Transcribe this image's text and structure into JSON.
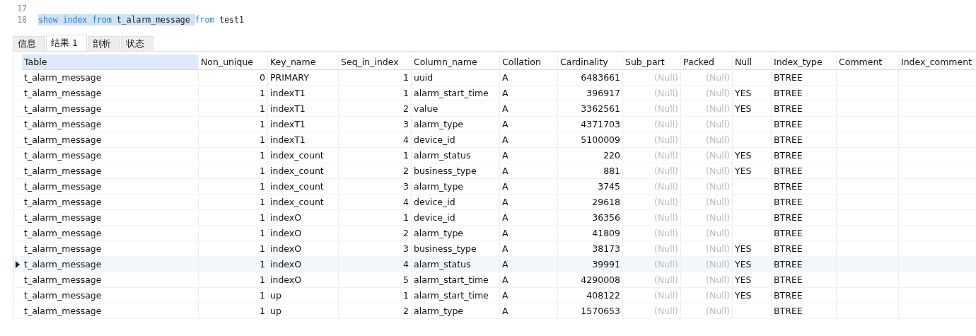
{
  "editor": {
    "lines": [
      {
        "number": "17"
      },
      {
        "number": "18",
        "tokens": [
          {
            "text": "show ",
            "kind": "keyword",
            "selected": true
          },
          {
            "text": "index ",
            "kind": "keyword",
            "selected": true
          },
          {
            "text": "from ",
            "kind": "keyword",
            "selected": true
          },
          {
            "text": "t_alarm_message ",
            "kind": "plain",
            "selected": true
          },
          {
            "text": "from ",
            "kind": "keyword",
            "selected": false
          },
          {
            "text": "test1",
            "kind": "plain",
            "selected": false
          }
        ]
      }
    ]
  },
  "tabs": [
    {
      "label": "信息",
      "selected": false
    },
    {
      "label": "结果 1",
      "selected": true
    },
    {
      "label": "剖析",
      "selected": false
    },
    {
      "label": "状态",
      "selected": false
    }
  ],
  "table": {
    "columns": [
      {
        "label": "Table",
        "kind": "text",
        "selected": true
      },
      {
        "label": "Non_unique",
        "kind": "number",
        "selected": false
      },
      {
        "label": "Key_name",
        "kind": "text",
        "selected": false
      },
      {
        "label": "Seq_in_index",
        "kind": "number",
        "selected": false
      },
      {
        "label": "Column_name",
        "kind": "text",
        "selected": false
      },
      {
        "label": "Collation",
        "kind": "text",
        "selected": false
      },
      {
        "label": "Cardinality",
        "kind": "number",
        "selected": false
      },
      {
        "label": "Sub_part",
        "kind": "null",
        "selected": false
      },
      {
        "label": "Packed",
        "kind": "null",
        "selected": false
      },
      {
        "label": "Null",
        "kind": "text",
        "selected": false
      },
      {
        "label": "Index_type",
        "kind": "text",
        "selected": false
      },
      {
        "label": "Comment",
        "kind": "text",
        "selected": false
      },
      {
        "label": "Index_comment",
        "kind": "text",
        "selected": false
      }
    ],
    "rows": [
      {
        "selected": false,
        "cells": [
          "t_alarm_message",
          "0",
          "PRIMARY",
          "1",
          "uuid",
          "A",
          "6483661",
          "(Null)",
          "(Null)",
          null,
          "BTREE",
          null,
          null
        ]
      },
      {
        "selected": false,
        "cells": [
          "t_alarm_message",
          "1",
          "indexT1",
          "1",
          "alarm_start_time",
          "A",
          "396917",
          "(Null)",
          "(Null)",
          "YES",
          "BTREE",
          null,
          null
        ]
      },
      {
        "selected": false,
        "cells": [
          "t_alarm_message",
          "1",
          "indexT1",
          "2",
          "value",
          "A",
          "3362561",
          "(Null)",
          "(Null)",
          "YES",
          "BTREE",
          null,
          null
        ]
      },
      {
        "selected": false,
        "cells": [
          "t_alarm_message",
          "1",
          "indexT1",
          "3",
          "alarm_type",
          "A",
          "4371703",
          "(Null)",
          "(Null)",
          null,
          "BTREE",
          null,
          null
        ]
      },
      {
        "selected": false,
        "cells": [
          "t_alarm_message",
          "1",
          "indexT1",
          "4",
          "device_id",
          "A",
          "5100009",
          "(Null)",
          "(Null)",
          null,
          "BTREE",
          null,
          null
        ]
      },
      {
        "selected": false,
        "cells": [
          "t_alarm_message",
          "1",
          "index_count",
          "1",
          "alarm_status",
          "A",
          "220",
          "(Null)",
          "(Null)",
          "YES",
          "BTREE",
          null,
          null
        ]
      },
      {
        "selected": false,
        "cells": [
          "t_alarm_message",
          "1",
          "index_count",
          "2",
          "business_type",
          "A",
          "881",
          "(Null)",
          "(Null)",
          "YES",
          "BTREE",
          null,
          null
        ]
      },
      {
        "selected": false,
        "cells": [
          "t_alarm_message",
          "1",
          "index_count",
          "3",
          "alarm_type",
          "A",
          "3745",
          "(Null)",
          "(Null)",
          null,
          "BTREE",
          null,
          null
        ]
      },
      {
        "selected": false,
        "cells": [
          "t_alarm_message",
          "1",
          "index_count",
          "4",
          "device_id",
          "A",
          "29618",
          "(Null)",
          "(Null)",
          null,
          "BTREE",
          null,
          null
        ]
      },
      {
        "selected": false,
        "cells": [
          "t_alarm_message",
          "1",
          "indexO",
          "1",
          "device_id",
          "A",
          "36356",
          "(Null)",
          "(Null)",
          null,
          "BTREE",
          null,
          null
        ]
      },
      {
        "selected": false,
        "cells": [
          "t_alarm_message",
          "1",
          "indexO",
          "2",
          "alarm_type",
          "A",
          "41809",
          "(Null)",
          "(Null)",
          null,
          "BTREE",
          null,
          null
        ]
      },
      {
        "selected": false,
        "cells": [
          "t_alarm_message",
          "1",
          "indexO",
          "3",
          "business_type",
          "A",
          "38173",
          "(Null)",
          "(Null)",
          "YES",
          "BTREE",
          null,
          null
        ]
      },
      {
        "selected": true,
        "cells": [
          "t_alarm_message",
          "1",
          "indexO",
          "4",
          "alarm_status",
          "A",
          "39991",
          "(Null)",
          "(Null)",
          "YES",
          "BTREE",
          null,
          null
        ]
      },
      {
        "selected": false,
        "cells": [
          "t_alarm_message",
          "1",
          "indexO",
          "5",
          "alarm_start_time",
          "A",
          "4290008",
          "(Null)",
          "(Null)",
          "YES",
          "BTREE",
          null,
          null
        ]
      },
      {
        "selected": false,
        "cells": [
          "t_alarm_message",
          "1",
          "up",
          "1",
          "alarm_start_time",
          "A",
          "408122",
          "(Null)",
          "(Null)",
          "YES",
          "BTREE",
          null,
          null
        ]
      },
      {
        "selected": false,
        "cells": [
          "t_alarm_message",
          "1",
          "up",
          "2",
          "alarm_type",
          "A",
          "1570653",
          "(Null)",
          "(Null)",
          null,
          "BTREE",
          null,
          null
        ]
      }
    ]
  }
}
